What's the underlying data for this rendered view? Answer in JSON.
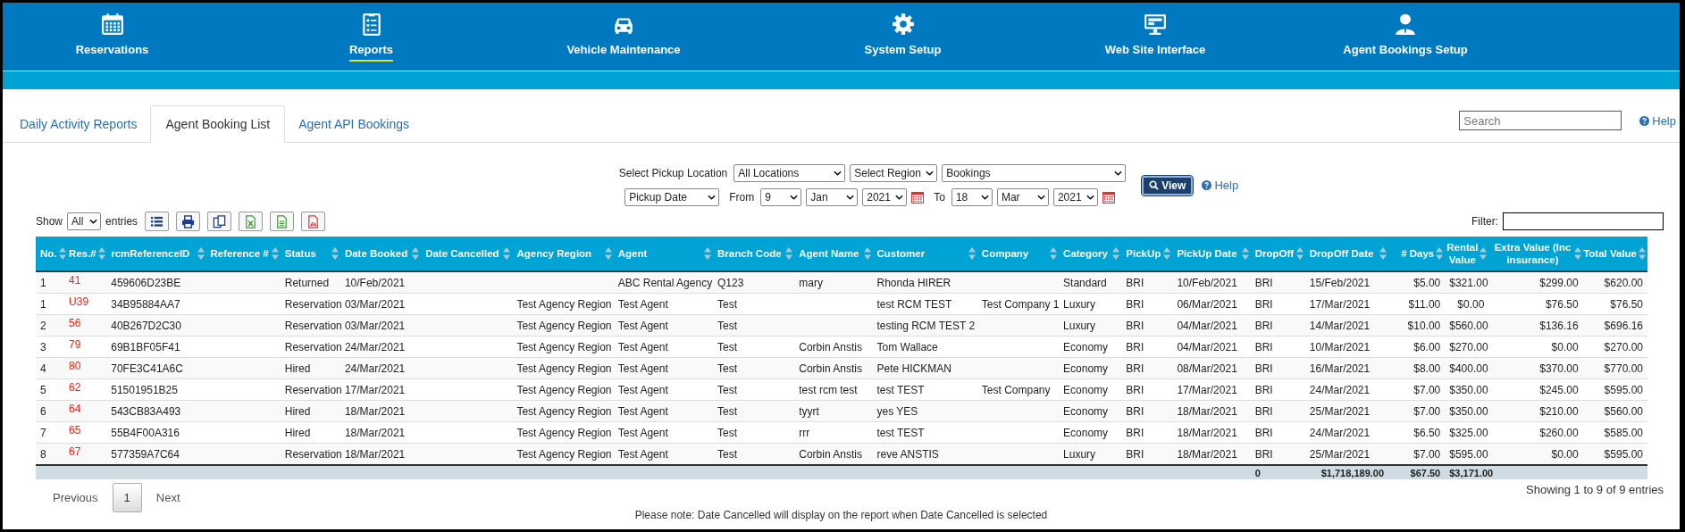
{
  "nav": [
    {
      "label": "Reservations",
      "selected": false
    },
    {
      "label": "Reports",
      "selected": true
    },
    {
      "label": "Vehicle Maintenance",
      "selected": false
    },
    {
      "label": "System Setup",
      "selected": false
    },
    {
      "label": "Web Site Interface",
      "selected": false
    },
    {
      "label": "Agent Bookings Setup",
      "selected": false
    }
  ],
  "tabs": [
    {
      "label": "Daily Activity Reports",
      "selected": false
    },
    {
      "label": "Agent Booking List",
      "selected": true
    },
    {
      "label": "Agent API Bookings",
      "selected": false
    }
  ],
  "search": {
    "placeholder": "Search"
  },
  "help_link": "Help",
  "filters": {
    "location_label": "Select Pickup Location",
    "location": "All Locations",
    "region": "Select Region",
    "report": "Bookings",
    "date_type": "Pickup Date",
    "from_label": "From",
    "from_day": "9",
    "from_month": "Jan",
    "from_year": "2021",
    "to_label": "To",
    "to_day": "18",
    "to_month": "Mar",
    "to_year": "2021",
    "view_button": "View",
    "help": "Help"
  },
  "entries": {
    "show_label": "Show",
    "value": "All",
    "entries_label": "entries",
    "filter_label": "Filter:"
  },
  "table": {
    "columns": [
      "No.",
      "Res.#",
      "rcmReferenceID",
      "Reference #",
      "Status",
      "Date Booked",
      "Date Cancelled",
      "Agency Region",
      "Agent",
      "Branch Code",
      "Agent Name",
      "Customer",
      "Company",
      "Category",
      "PickUp",
      "PickUp Date",
      "DropOff",
      "DropOff Date",
      "# Days",
      "Rental Value",
      "Extra Value (Inc insurance)",
      "Total Value"
    ],
    "rows": [
      {
        "no": "1",
        "res": "41",
        "rcm_id": "459606D23BE",
        "status": "Returned",
        "date_booked": "10/Feb/2021",
        "agent": "ABC Rental Agency",
        "branch_code": "Q123",
        "agent_name": "mary",
        "customer": "Rhonda HIRER",
        "category": "Standard",
        "pickup": "BRI",
        "pickup_date": "10/Feb/2021",
        "dropoff": "BRI",
        "dropoff_date": "15/Feb/2021",
        "days": "$5.00",
        "rental_value": "$321.00",
        "extra_value": "$299.00",
        "total_value": "$620.00"
      },
      {
        "no": "1",
        "res": "U39",
        "rcm_id": "34B95884AA7",
        "status": "Reservation",
        "date_booked": "03/Mar/2021",
        "agency_region": "Test Agency Region",
        "agent": "Test Agent",
        "branch_code": "Test",
        "customer": "test RCM TEST",
        "company": "Test Company 1",
        "category": "Luxury",
        "pickup": "BRI",
        "pickup_date": "06/Mar/2021",
        "dropoff": "BRI",
        "dropoff_date": "17/Mar/2021",
        "days": "$11.00",
        "rental_value": "$0.00",
        "extra_value": "$76.50",
        "total_value": "$76.50"
      },
      {
        "no": "2",
        "res": "56",
        "rcm_id": "40B267D2C30",
        "status": "Reservation",
        "date_booked": "03/Mar/2021",
        "agency_region": "Test Agency Region",
        "agent": "Test Agent",
        "branch_code": "Test",
        "customer": "testing RCM TEST 2",
        "category": "Luxury",
        "pickup": "BRI",
        "pickup_date": "04/Mar/2021",
        "dropoff": "BRI",
        "dropoff_date": "14/Mar/2021",
        "days": "$10.00",
        "rental_value": "$560.00",
        "extra_value": "$136.16",
        "total_value": "$696.16"
      },
      {
        "no": "3",
        "res": "79",
        "rcm_id": "69B1BF05F41",
        "status": "Reservation",
        "date_booked": "24/Mar/2021",
        "agency_region": "Test Agency Region",
        "agent": "Test Agent",
        "branch_code": "Test",
        "agent_name": "Corbin Anstis",
        "customer": "Tom Wallace",
        "category": "Economy",
        "pickup": "BRI",
        "pickup_date": "04/Mar/2021",
        "dropoff": "BRI",
        "dropoff_date": "10/Mar/2021",
        "days": "$6.00",
        "rental_value": "$270.00",
        "extra_value": "$0.00",
        "total_value": "$270.00"
      },
      {
        "no": "4",
        "res": "80",
        "rcm_id": "70FE3C41A6C",
        "status": "Hired",
        "date_booked": "24/Mar/2021",
        "agency_region": "Test Agency Region",
        "agent": "Test Agent",
        "branch_code": "Test",
        "agent_name": "Corbin Anstis",
        "customer": "Pete HICKMAN",
        "category": "Economy",
        "pickup": "BRI",
        "pickup_date": "08/Mar/2021",
        "dropoff": "BRI",
        "dropoff_date": "16/Mar/2021",
        "days": "$8.00",
        "rental_value": "$400.00",
        "extra_value": "$370.00",
        "total_value": "$770.00"
      },
      {
        "no": "5",
        "res": "62",
        "rcm_id": "51501951B25",
        "status": "Reservation",
        "date_booked": "17/Mar/2021",
        "agency_region": "Test Agency Region",
        "agent": "Test Agent",
        "branch_code": "Test",
        "agent_name": "test rcm test",
        "customer": "test TEST",
        "company": "Test Company",
        "category": "Economy",
        "pickup": "BRI",
        "pickup_date": "17/Mar/2021",
        "dropoff": "BRI",
        "dropoff_date": "24/Mar/2021",
        "days": "$7.00",
        "rental_value": "$350.00",
        "extra_value": "$245.00",
        "total_value": "$595.00"
      },
      {
        "no": "6",
        "res": "64",
        "rcm_id": "543CB83A493",
        "status": "Hired",
        "date_booked": "18/Mar/2021",
        "agency_region": "Test Agency Region",
        "agent": "Test Agent",
        "branch_code": "Test",
        "agent_name": "tyyrt",
        "customer": "yes YES",
        "category": "Economy",
        "pickup": "BRI",
        "pickup_date": "18/Mar/2021",
        "dropoff": "BRI",
        "dropoff_date": "25/Mar/2021",
        "days": "$7.00",
        "rental_value": "$350.00",
        "extra_value": "$210.00",
        "total_value": "$560.00"
      },
      {
        "no": "7",
        "res": "65",
        "rcm_id": "55B4F00A316",
        "status": "Hired",
        "date_booked": "18/Mar/2021",
        "agency_region": "Test Agency Region",
        "agent": "Test Agent",
        "branch_code": "Test",
        "agent_name": "rrr",
        "customer": "test TEST",
        "category": "Economy",
        "pickup": "BRI",
        "pickup_date": "18/Mar/2021",
        "dropoff": "BRI",
        "dropoff_date": "24/Mar/2021",
        "days": "$6.50",
        "rental_value": "$325.00",
        "extra_value": "$260.00",
        "total_value": "$585.00"
      },
      {
        "no": "8",
        "res": "67",
        "rcm_id": "577359A7C64",
        "status": "Reservation",
        "date_booked": "18/Mar/2021",
        "agency_region": "Test Agency Region",
        "agent": "Test Agent",
        "branch_code": "Test",
        "agent_name": "Corbin Anstis",
        "customer": "reve ANSTIS",
        "category": "Luxury",
        "pickup": "BRI",
        "pickup_date": "18/Mar/2021",
        "dropoff": "BRI",
        "dropoff_date": "25/Mar/2021",
        "days": "$7.00",
        "rental_value": "$595.00",
        "extra_value": "$0.00",
        "total_value": "$595.00"
      }
    ],
    "totals": {
      "dropoff": "0",
      "dropoff_date": "$1,718,189.00",
      "days": "$67.50",
      "rental_value": "$3,171.00"
    }
  },
  "pagination": {
    "previous": "Previous",
    "pages": [
      {
        "label": "1",
        "selected": true
      }
    ],
    "next": "Next"
  },
  "info": "Showing 1 to 9 of 9 entries",
  "note": "Please note: Date Cancelled will display on the report when Date Cancelled is selected"
}
